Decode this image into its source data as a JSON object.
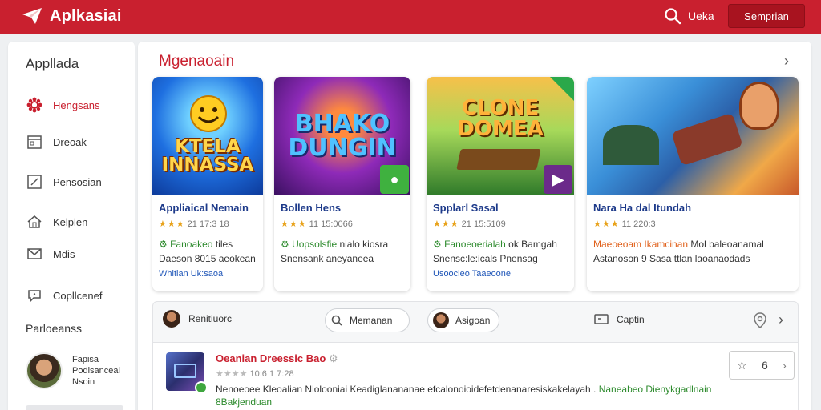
{
  "header": {
    "app_name": "Aplkasiai",
    "search_label": "Ueka",
    "signin_label": "Semprian"
  },
  "sidebar": {
    "title": "Appllada",
    "items": [
      {
        "label": "Hengsans",
        "icon": "gear-flower-icon",
        "active": true
      },
      {
        "label": "Dreoak",
        "icon": "calendar-icon"
      },
      {
        "label": "Pensosian",
        "icon": "edit-icon"
      },
      {
        "label": "Kelplen",
        "icon": "home-icon"
      },
      {
        "label": "Mdis",
        "icon": "mail-icon"
      },
      {
        "label": "Copllcenef",
        "icon": "chat-icon"
      }
    ],
    "section": "Parloeanss",
    "user": {
      "line1": "Fapisa",
      "line2": "Podisanceal",
      "line3": "Nsoin"
    }
  },
  "main": {
    "section_title": "Mgenaoain",
    "cards": [
      {
        "art_text": "KTELA\nINNASSA",
        "name": "Appliaical Nemain",
        "stars": "★★★",
        "rating_text": "21 17:3 18",
        "meta1_green": "Fanoakeo",
        "meta1_rest": "tiles",
        "meta2": "Daeson 8015 aeokean",
        "meta3": "Whitlan Uk:saoa"
      },
      {
        "art_text": "BHAKO\nDUNGIN",
        "name": "Bollen Hens",
        "stars": "★★★",
        "rating_text": "11 15:0066",
        "meta1_green": "Uopsolsfie",
        "meta1_rest": "nialo kiosra",
        "meta2": "Snensank aneyaneea",
        "meta3": ""
      },
      {
        "art_text": "CLONE\nDOMEA",
        "name": "Spplarl Sasal",
        "stars": "★★★",
        "rating_text": "21 15:5109",
        "meta1_green": "Fanoeoerialah",
        "meta1_rest": "ok Bamgah",
        "meta2": "Snensc:le:icals Pnensag",
        "meta3": "Usoocleo Taaeoone"
      },
      {
        "art_text": "",
        "name": "Nara Ha dal Itundah",
        "stars": "★★★",
        "rating_text": "11 220:3",
        "meta1_orange": "Maeoeoam Ikamcinan",
        "meta1_rest": "Mol baleoanamal",
        "meta2": "Astanoson 9 Sasa ttlan laoanaodads",
        "meta3": ""
      }
    ],
    "filters": [
      {
        "label": "Renitiuorc",
        "type": "avatar"
      },
      {
        "label": "Memanan",
        "type": "search"
      },
      {
        "label": "Asigoan",
        "type": "avatar"
      },
      {
        "label": "Captin",
        "type": "monitor"
      }
    ],
    "list_item": {
      "title": "Oeanian Dreessic Bao",
      "rating_text": "10:6 1 7:28",
      "description": "Nenoeoee Kleoalian Nlolooniai Keadiglanananae efcalonoioidefetdenanaresiskakelayah .",
      "description_green": "Naneabeo Dienykgadlnain 8Bakjenduan",
      "fav_count": "6"
    }
  },
  "colors": {
    "brand": "#c9202f",
    "link": "#1d3a8a",
    "green": "#2e8b2e",
    "star": "#e8a21a"
  }
}
